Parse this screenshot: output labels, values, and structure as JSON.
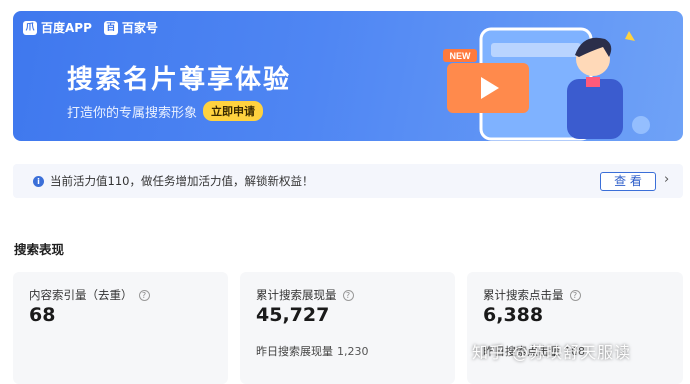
{
  "banner": {
    "brand1": "百度APP",
    "brand2": "百家号",
    "title": "搜索名片尊享体验",
    "subtitle": "打造你的专属搜索形象",
    "apply_label": "立即申请",
    "new_tag": "NEW"
  },
  "notice": {
    "text": "当前活力值110，做任务增加活力值，解锁新权益！",
    "view_label": "查 看"
  },
  "section": {
    "title": "搜索表现"
  },
  "cards": [
    {
      "label": "内容索引量（去重）",
      "value": "68"
    },
    {
      "label": "累计搜索展现量",
      "value": "45,727",
      "sub_label": "昨日搜索展现量",
      "sub_value": "1,230"
    },
    {
      "label": "累计搜索点击量",
      "value": "6,388",
      "sub_label": "昨日搜索点击量",
      "sub_value": "168"
    }
  ],
  "watermark": "知乎 @苏映舒天服读"
}
